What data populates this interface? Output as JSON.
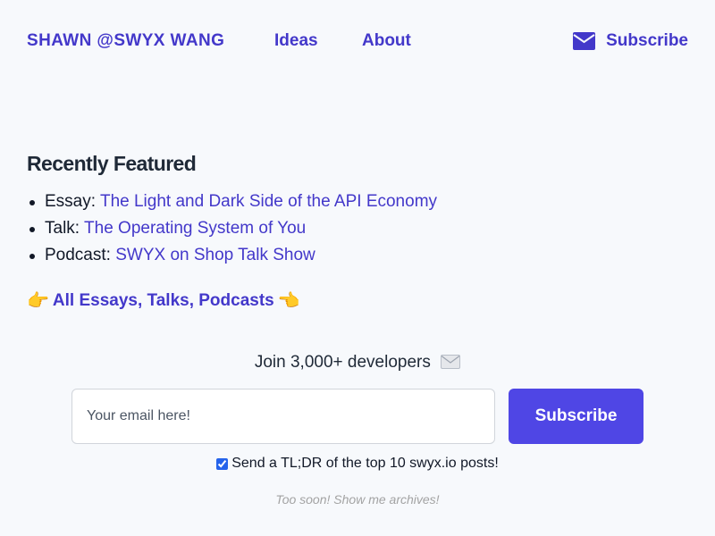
{
  "header": {
    "brand": "SHAWN @SWYX WANG",
    "nav": [
      {
        "label": "Ideas"
      },
      {
        "label": "About"
      }
    ],
    "subscribe_label": "Subscribe",
    "subscribe_icon": "envelope-icon"
  },
  "featured": {
    "heading": "Recently Featured",
    "items": [
      {
        "prefix": "Essay: ",
        "link": "The Light and Dark Side of the API Economy"
      },
      {
        "prefix": "Talk: ",
        "link": "The Operating System of You"
      },
      {
        "prefix": "Podcast: ",
        "link": "SWYX on Shop Talk Show"
      }
    ],
    "all_link": "All Essays, Talks, Podcasts",
    "hand_left": "👉",
    "hand_right": "👈"
  },
  "newsletter": {
    "join_text": "Join 3,000+ developers",
    "email_placeholder": "Your email here!",
    "email_value": "",
    "button_label": "Subscribe",
    "tldr_label": "Send a TL;DR of the top 10 swyx.io posts!",
    "tldr_checked": true,
    "archives_text": "Too soon! Show me archives!"
  },
  "colors": {
    "accent": "#4338ca",
    "button": "#4f46e5",
    "background": "#f7f9fc"
  }
}
